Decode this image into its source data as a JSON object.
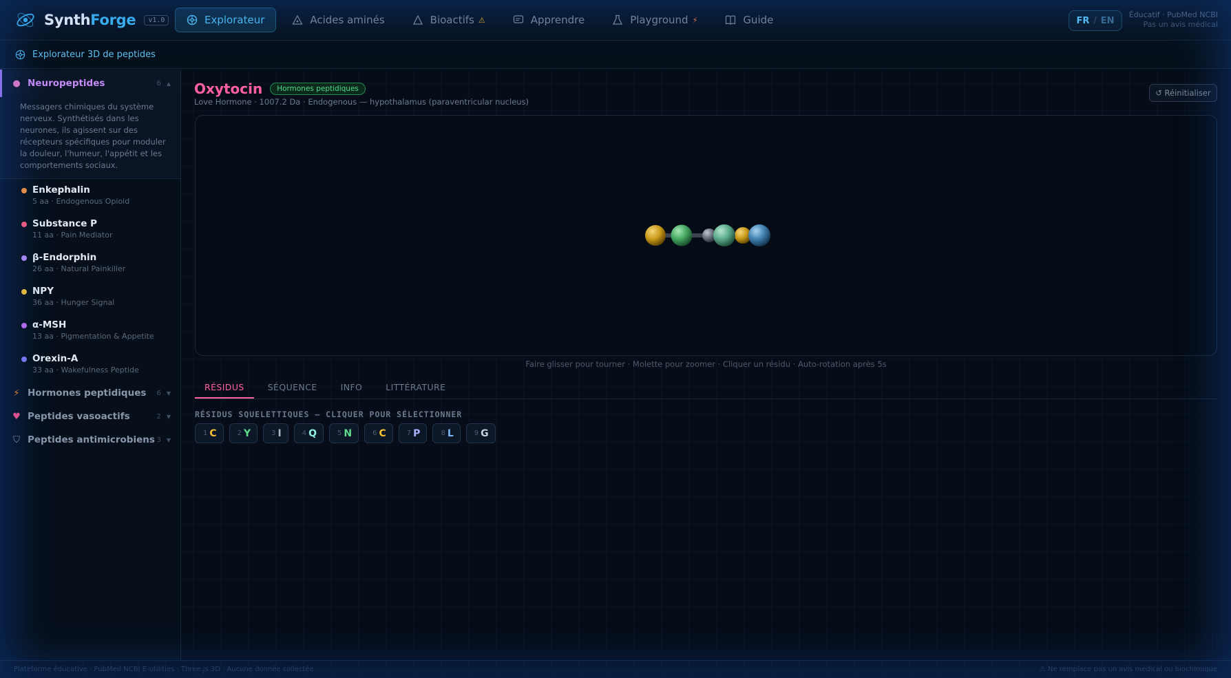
{
  "brand": {
    "name_a": "Synth",
    "name_b": "Forge",
    "version": "v1.0"
  },
  "nav": {
    "items": [
      {
        "label": "Explorateur",
        "icon": "atom-icon",
        "active": true
      },
      {
        "label": "Acides aminés",
        "icon": "triangle-icon"
      },
      {
        "label": "Bioactifs",
        "icon": "triangle-outline-icon",
        "badge": "⚠"
      },
      {
        "label": "Apprendre",
        "icon": "chat-icon"
      },
      {
        "label": "Playground",
        "icon": "flask-icon",
        "badge": "⚡"
      },
      {
        "label": "Guide",
        "icon": "book-icon"
      }
    ]
  },
  "lang": {
    "fr": "FR",
    "sep": "/",
    "en": "EN"
  },
  "disclaimer": {
    "line1": "Éducatif · PubMed NCBI",
    "line2": "Pas un avis médical"
  },
  "subbar": {
    "label": "Explorateur 3D de peptides"
  },
  "sidebar": {
    "active_category": {
      "label": "Neuropeptides",
      "count": "6",
      "icon": "brain-icon",
      "description": "Messagers chimiques du système nerveux. Synthétisés dans les neurones, ils agissent sur des récepteurs spécifiques pour moduler la douleur, l'humeur, l'appétit et les comportements sociaux.",
      "peptides": [
        {
          "name": "Enkephalin",
          "meta": "5 aa · Endogenous Opioid",
          "color": "#f7953b"
        },
        {
          "name": "Substance P",
          "meta": "11 aa · Pain Mediator",
          "color": "#ff5c7a"
        },
        {
          "name": "β-Endorphin",
          "meta": "26 aa · Natural Painkiller",
          "color": "#b38cf7"
        },
        {
          "name": "NPY",
          "meta": "36 aa · Hunger Signal",
          "color": "#f5c232"
        },
        {
          "name": "α-MSH",
          "meta": "13 aa · Pigmentation & Appetite",
          "color": "#c06cf0"
        },
        {
          "name": "Orexin-A",
          "meta": "33 aa · Wakefulness Peptide",
          "color": "#7f7cf7"
        }
      ]
    },
    "other_categories": [
      {
        "label": "Hormones peptidiques",
        "count": "6",
        "icon": "bolt-icon",
        "glyph": "⚡",
        "color": "#ff8a2a"
      },
      {
        "label": "Peptides vasoactifs",
        "count": "2",
        "icon": "heart-icon",
        "glyph": "♥",
        "color": "#ff4f8a"
      },
      {
        "label": "Peptides antimicrobiens",
        "count": "3",
        "icon": "shield-icon",
        "glyph": "⛉",
        "color": "#8a97aa"
      }
    ]
  },
  "detail": {
    "title": "Oxytocin",
    "badge": "Hormones peptidiques",
    "subtitle": "Love Hormone · 1007.2 Da · Endogenous — hypothalamus (paraventricular nucleus)",
    "reset_label": "↺ Réinitialiser",
    "hint": "Faire glisser pour tourner · Molette pour zoomer · Cliquer un résidu · Auto-rotation après 5s",
    "tabs": [
      "RÉSIDUS",
      "SÉQUENCE",
      "INFO",
      "LITTÉRATURE"
    ],
    "residues_heading": "RÉSIDUS SQUELETTIQUES — CLIQUER POUR SÉLECTIONNER",
    "residues": [
      {
        "num": "1",
        "aa": "C",
        "color": "#f5c232"
      },
      {
        "num": "2",
        "aa": "Y",
        "color": "#5fdc8c"
      },
      {
        "num": "3",
        "aa": "I",
        "color": "#aeb9c7"
      },
      {
        "num": "4",
        "aa": "Q",
        "color": "#8ff0e0"
      },
      {
        "num": "5",
        "aa": "N",
        "color": "#5fdc8c"
      },
      {
        "num": "6",
        "aa": "C",
        "color": "#f5c232"
      },
      {
        "num": "7",
        "aa": "P",
        "color": "#a7b3ff"
      },
      {
        "num": "8",
        "aa": "L",
        "color": "#7fb4f5"
      },
      {
        "num": "9",
        "aa": "G",
        "color": "#c9d2de"
      }
    ]
  },
  "footer": {
    "left": "Plateforme éducative · PubMed NCBI E-utilities · Three.js 3D · Aucune donnée collectée",
    "right": "⚠ Ne remplace pas un avis médical ou biochimique"
  }
}
